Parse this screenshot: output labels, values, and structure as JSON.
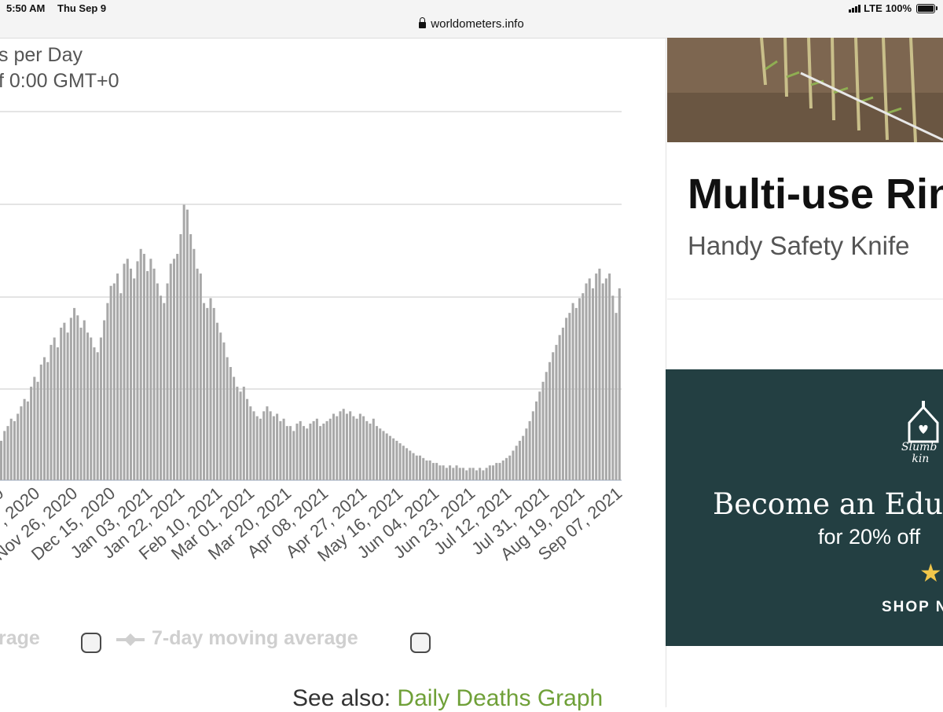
{
  "status_bar": {
    "time": "5:50 AM",
    "date": "Thu Sep 9",
    "network": "LTE",
    "battery": "100%",
    "url": "worldometers.info"
  },
  "chart": {
    "title_line1": "s per Day",
    "title_line2": "f 0:00 GMT+0",
    "legend": {
      "left_partial": "rage",
      "moving_average": "7-day moving average"
    }
  },
  "chart_data": {
    "type": "bar",
    "x_tick_labels": [
      "0",
      ", 2020",
      "Nov 26, 2020",
      "Dec 15, 2020",
      "Jan 03, 2021",
      "Jan 22, 2021",
      "Feb 10, 2021",
      "Mar 01, 2021",
      "Mar 20, 2021",
      "Apr 08, 2021",
      "Apr 27, 2021",
      "May 16, 2021",
      "Jun 04, 2021",
      "Jun 23, 2021",
      "Jul 12, 2021",
      "Jul 31, 2021",
      "Aug 19, 2021",
      "Sep 07, 2021"
    ],
    "values_relative": [
      0.16,
      0.2,
      0.22,
      0.25,
      0.24,
      0.27,
      0.3,
      0.33,
      0.32,
      0.38,
      0.42,
      0.4,
      0.47,
      0.5,
      0.48,
      0.55,
      0.58,
      0.54,
      0.62,
      0.64,
      0.6,
      0.66,
      0.7,
      0.67,
      0.62,
      0.65,
      0.6,
      0.58,
      0.54,
      0.52,
      0.58,
      0.65,
      0.72,
      0.79,
      0.8,
      0.84,
      0.76,
      0.88,
      0.9,
      0.86,
      0.82,
      0.89,
      0.94,
      0.92,
      0.85,
      0.9,
      0.86,
      0.8,
      0.75,
      0.72,
      0.8,
      0.88,
      0.9,
      0.92,
      1.0,
      1.12,
      1.1,
      1.0,
      0.94,
      0.86,
      0.84,
      0.72,
      0.7,
      0.74,
      0.7,
      0.64,
      0.6,
      0.56,
      0.5,
      0.46,
      0.42,
      0.38,
      0.36,
      0.38,
      0.33,
      0.3,
      0.28,
      0.26,
      0.25,
      0.28,
      0.3,
      0.28,
      0.26,
      0.27,
      0.24,
      0.25,
      0.22,
      0.22,
      0.2,
      0.23,
      0.24,
      0.22,
      0.21,
      0.23,
      0.24,
      0.25,
      0.22,
      0.23,
      0.24,
      0.25,
      0.27,
      0.26,
      0.28,
      0.29,
      0.27,
      0.28,
      0.26,
      0.25,
      0.27,
      0.26,
      0.24,
      0.23,
      0.25,
      0.22,
      0.21,
      0.2,
      0.19,
      0.18,
      0.17,
      0.16,
      0.15,
      0.14,
      0.13,
      0.12,
      0.11,
      0.1,
      0.1,
      0.09,
      0.08,
      0.08,
      0.07,
      0.07,
      0.06,
      0.06,
      0.05,
      0.06,
      0.05,
      0.06,
      0.05,
      0.05,
      0.04,
      0.05,
      0.05,
      0.04,
      0.05,
      0.04,
      0.05,
      0.06,
      0.06,
      0.07,
      0.07,
      0.08,
      0.09,
      0.1,
      0.12,
      0.14,
      0.16,
      0.18,
      0.21,
      0.24,
      0.28,
      0.32,
      0.36,
      0.4,
      0.44,
      0.48,
      0.52,
      0.55,
      0.59,
      0.62,
      0.66,
      0.68,
      0.72,
      0.7,
      0.74,
      0.76,
      0.8,
      0.82,
      0.78,
      0.84,
      0.86,
      0.8,
      0.82,
      0.84,
      0.75,
      0.68,
      0.78
    ],
    "grid": true,
    "legend_position": "bottom"
  },
  "see_also": {
    "prefix": "See also: ",
    "link": "Daily Deaths Graph"
  },
  "ad_top": {
    "title": "Multi-use Rin",
    "subtitle": "Handy Safety Knife"
  },
  "ad_bottom": {
    "brand": "Slumb\nkin",
    "headline": "Become an Edu",
    "offer": "for 20% off",
    "star": "★",
    "cta": "SHOP N"
  },
  "colors": {
    "bar": "#a8a8a8",
    "grid": "#e4e4e4",
    "link": "#6fa038",
    "ad_bg": "#233f42",
    "star": "#f2c64a"
  }
}
